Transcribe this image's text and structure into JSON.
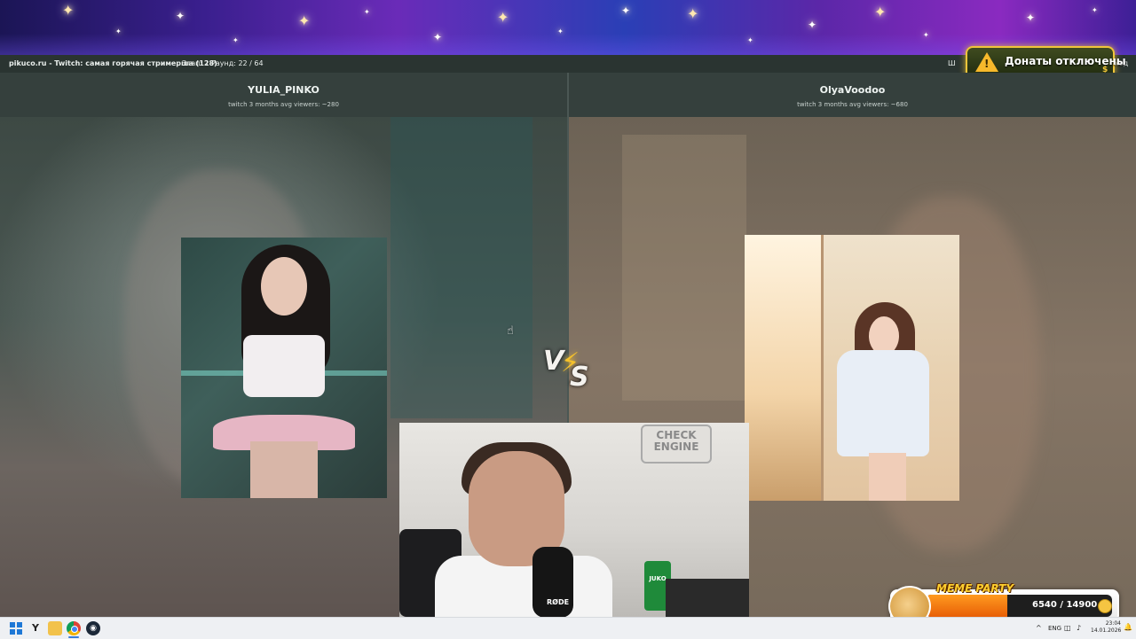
{
  "topbar": {
    "site_title": "pikuco.ru - Twitch: самая горячая стримерша (128)",
    "stage": "Этап: 1",
    "round": "Раунд: 22 / 64",
    "right_fragment_1": "Ш",
    "right_fragment_2": "ход"
  },
  "donations_badge": {
    "label": "Донаты отключены",
    "coin_symbol": "$",
    "icon": "warning-icon"
  },
  "left_contestant": {
    "name": "YULIA_PINKO",
    "stats": "twitch 3 months avg viewers: ~280"
  },
  "right_contestant": {
    "name": "OlyaVoodoo",
    "stats": "twitch 3 months avg viewers: ~680"
  },
  "vs": {
    "v": "V",
    "s": "S",
    "bolt": "⚡"
  },
  "webcam": {
    "sign_text": "CHECK ENGINE",
    "mic_brand": "RØDE",
    "can_label": "JUKO"
  },
  "meme_party": {
    "title": "MEME PARTY",
    "progress_text": "6540 / 14900",
    "progress_fraction": 0.44,
    "colors": {
      "fill": "#e85f07",
      "title": "#ffcf2f"
    }
  },
  "taskbar": {
    "icons": [
      "windows-start-icon",
      "yandex-browser-icon",
      "file-explorer-icon",
      "chrome-icon",
      "steam-icon"
    ],
    "yandex_glyph": "Y",
    "steam_glyph": "◉",
    "tray_caret": "^",
    "language": "ENG",
    "network_glyph": "◫",
    "volume_glyph": "♪",
    "time": "23:04",
    "date": "14.01.2026",
    "bell_glyph": "🔔"
  },
  "cursor_glyph": "☝"
}
